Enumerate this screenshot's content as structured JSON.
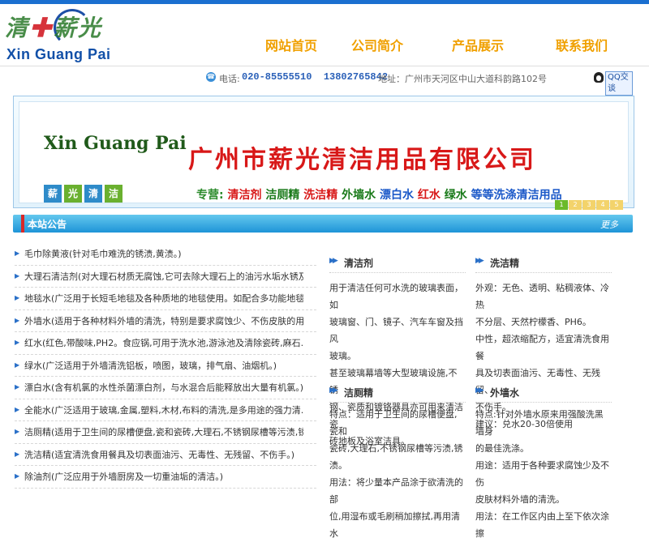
{
  "header": {
    "logo_text": "Xin Guang Pai",
    "nav": [
      "网站首页",
      "公司简介",
      "产品展示",
      "联系我们"
    ]
  },
  "contact": {
    "phone_label": "电话:",
    "phones": "020-85555510  13802765842",
    "address": "地址：广州市天河区中山大道科韵路102号",
    "qq_label": "QQ交谈"
  },
  "banner": {
    "english": "Xin Guang Pai",
    "company": "广州市薪光清洁用品有限公司",
    "main_label": "专营:",
    "products": [
      "清洁剂",
      "洁厕精",
      "洗洁精",
      "外墙水",
      "漂白水",
      "红水",
      "绿水",
      "等等洗涤清洁用品"
    ],
    "blocks": [
      "薪",
      "光",
      "清",
      "洁"
    ],
    "pages": [
      "1",
      "2",
      "3",
      "4",
      "5"
    ],
    "colors": {
      "company": "#d81818",
      "products": [
        "#d81818",
        "#1a7a1a",
        "#d81818",
        "#1a7a1a",
        "#1a58c8",
        "#d81818",
        "#1a7a1a",
        "#1a58c8"
      ]
    }
  },
  "notice": {
    "title": "本站公告",
    "more": "更多",
    "items": [
      "毛巾除黄液(针对毛巾难洗的锈渍,黄渍。)",
      "大理石清洁剂(对大理石材质无腐蚀,它可去除大理石上的油污水垢水锈及...",
      "地毯水(广泛用于长短毛地毯及各种质地的地毯使用。如配合多功能地毯机...",
      "外墙水(适用于各种材料外墙的清洗，特别是要求腐蚀少、不伤皮肤的用户。)",
      "红水(红色,带酸味,PH2。食应锅,可用于洗水池,游泳池及清除瓷砖,麻石...",
      "绿水(广泛适用于外墙清洗铝板，喷图，玻璃，排气扇、油烟机。)",
      "漂白水(含有机氯的水性杀菌漂白剂，与水混合后能释放出大量有机氯。)",
      "全能水(广泛适用于玻璃,金属,塑料,木材,布料的清洗,是多用途的强力清...",
      "洁厕精(适用于卫生间的尿槽便盘,瓷和瓷砖,大理石,不锈钢尿槽等污渍,锈...",
      "洗洁精(适宜清洗食用餐具及切表面油污、无毒性、无残留、不伤手。)",
      "除油剂(广泛应用于外墙厨房及一切重油垢的清洁。)"
    ]
  },
  "products": {
    "qingjieji": {
      "title": "清洁剂",
      "lines": [
        "用于清洁任何可水洗的玻璃表面，如",
        "玻璃窗、门、镜子、汽车车窗及挡风",
        "玻璃。",
        "甚至玻璃幕墙等大型玻璃设施,不锈",
        "钢、瓷质和镀铬器具亦可用来清洁瓷",
        "砖地板及浴室洁具。"
      ]
    },
    "xijiejing": {
      "title": "洗洁精",
      "lines": [
        "外观：无色、透明、粘稠液体、冷热",
        "不分层、天然柠檬香、PH6。",
        "中性，超浓缩配方，适宜清洗食用餐",
        "具及切表面油污、无毒性、无残留、",
        "不伤手。",
        "建议：兑水20-30倍使用"
      ]
    },
    "jiecejing": {
      "title": "洁厕精",
      "lines": [
        "特点：适用于卫生间的尿槽便盘,瓷和",
        "瓷砖,大理石,不锈钢尿槽等污渍,锈",
        "渍。",
        "用法：将少量本产品涂于欲清洗的部",
        "位,用湿布或毛刷稍加擦拭,再用清水"
      ]
    },
    "waiqiangshui": {
      "title": "外墙水",
      "lines": [
        "特点:针对外墙水原来用强酸洗黑墙身",
        "的最佳洗涤。",
        "用途：适用于各种要求腐蚀少及不伤",
        "皮肤材料外墙的清洗。",
        "用法：在工作区内由上至下依次涂擦"
      ]
    }
  }
}
